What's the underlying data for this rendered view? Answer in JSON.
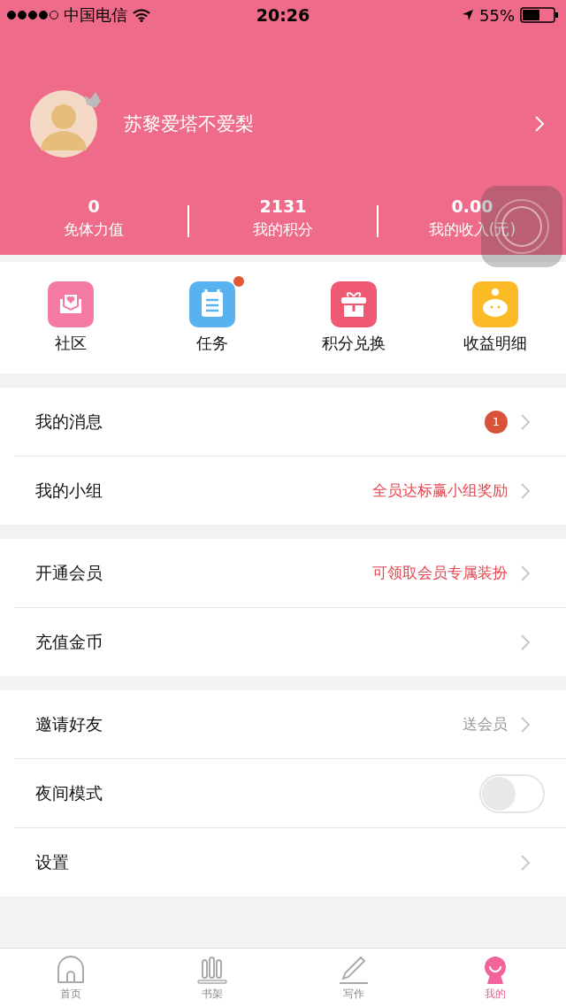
{
  "status_bar": {
    "carrier": "中国电信",
    "time": "20:26",
    "battery": "55%"
  },
  "profile": {
    "name": "苏黎爱塔不爱梨"
  },
  "stats": [
    {
      "value": "0",
      "label": "免体力值"
    },
    {
      "value": "2131",
      "label": "我的积分"
    },
    {
      "value": "0.00",
      "label": "我的收入(元)"
    }
  ],
  "shortcuts": [
    {
      "kind": "community",
      "label": "社区",
      "badge": false
    },
    {
      "kind": "tasks",
      "label": "任务",
      "badge": true
    },
    {
      "kind": "gift",
      "label": "积分兑换",
      "badge": false
    },
    {
      "kind": "income",
      "label": "收益明细",
      "badge": false
    }
  ],
  "sections": [
    [
      {
        "kind": "link",
        "label": "我的消息",
        "count": "1"
      },
      {
        "kind": "link",
        "label": "我的小组",
        "detail": "全员达标赢小组奖励",
        "color": "#e8454f"
      }
    ],
    [
      {
        "kind": "link",
        "label": "开通会员",
        "detail": "可领取会员专属装扮",
        "color": "#e8454f"
      },
      {
        "kind": "link",
        "label": "充值金币"
      }
    ],
    [
      {
        "kind": "link",
        "label": "邀请好友",
        "detail": "送会员",
        "color": "#999999"
      },
      {
        "kind": "toggle",
        "label": "夜间模式",
        "on": false
      },
      {
        "kind": "link",
        "label": "设置"
      }
    ]
  ],
  "tab_bar": [
    {
      "kind": "home",
      "label": "首页",
      "selected": false
    },
    {
      "kind": "shelf",
      "label": "书架",
      "selected": false
    },
    {
      "kind": "write",
      "label": "写作",
      "selected": false
    },
    {
      "kind": "me",
      "label": "我的",
      "selected": true
    }
  ]
}
